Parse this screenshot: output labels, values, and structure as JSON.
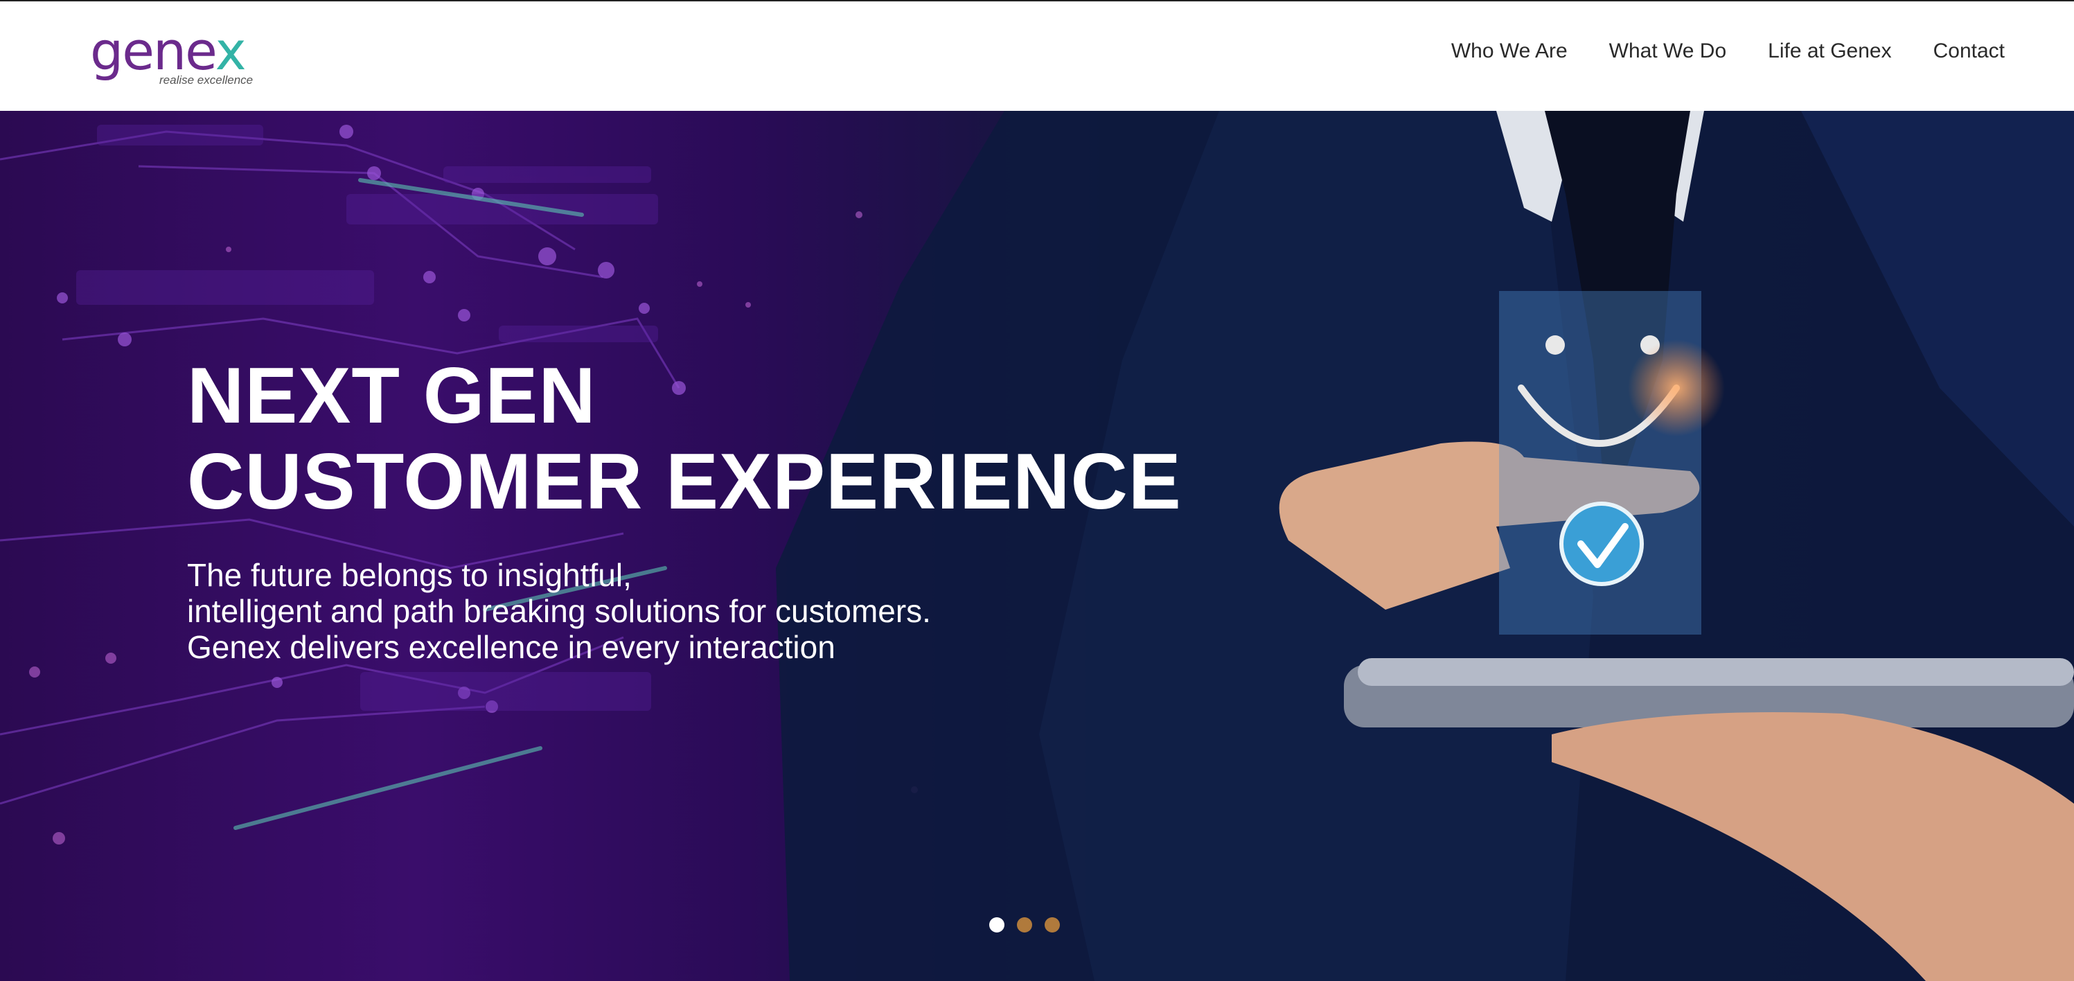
{
  "brand": {
    "logo_text": "gene",
    "logo_accent": "x",
    "tagline": "realise excellence",
    "color_primary": "#6b2a8c",
    "color_accent": "#33b3a6"
  },
  "nav": {
    "items": [
      {
        "label": "Who We Are"
      },
      {
        "label": "What We Do"
      },
      {
        "label": "Life at Genex"
      },
      {
        "label": "Contact"
      }
    ]
  },
  "hero": {
    "title_line1": "NEXT GEN",
    "title_line2": "CUSTOMER EXPERIENCE",
    "sub_line1": "The future belongs to insightful,",
    "sub_line2": "intelligent and path breaking solutions for customers.",
    "sub_line3": "Genex delivers excellence in every interaction",
    "image_icons": [
      "smiley-face-icon",
      "checkmark-icon"
    ]
  },
  "carousel": {
    "slide_count": 3,
    "active_index": 0,
    "active_color": "#ffffff",
    "inactive_color": "#b07a3c"
  }
}
